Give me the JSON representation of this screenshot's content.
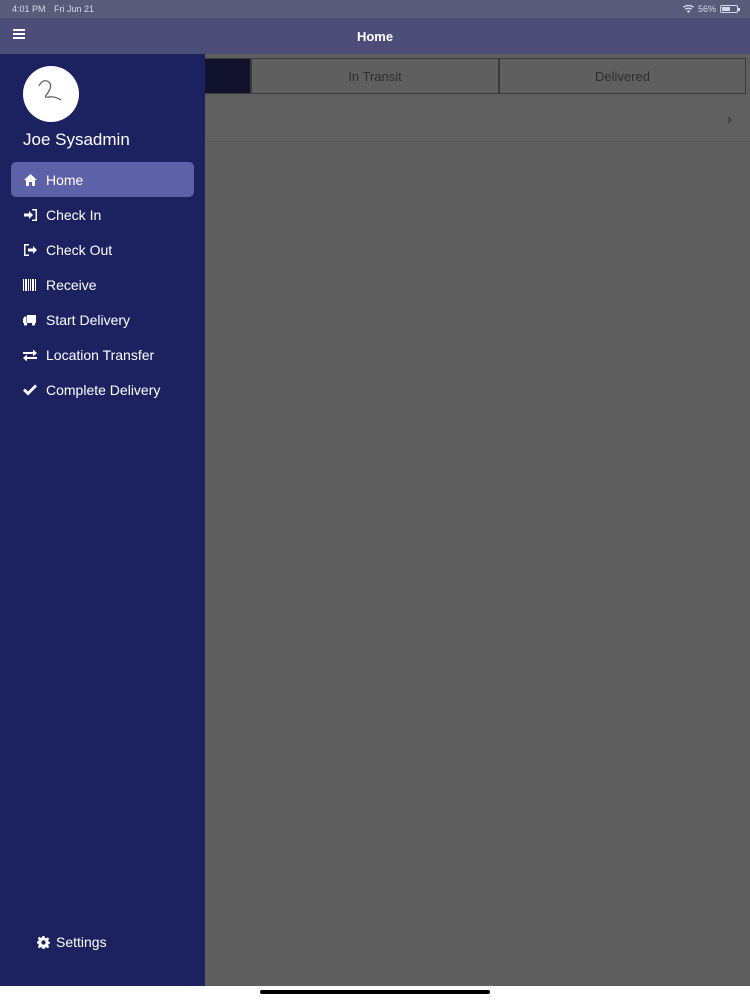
{
  "status_bar": {
    "time": "4:01 PM",
    "date": "Fri Jun 21",
    "battery": "56%",
    "battery_level": 0.56
  },
  "nav": {
    "title": "Home"
  },
  "segments": [
    {
      "label": ""
    },
    {
      "label": "In Transit"
    },
    {
      "label": "Delivered"
    }
  ],
  "drawer": {
    "user_name": "Joe Sysadmin",
    "items": [
      {
        "label": "Home",
        "icon": "home-icon",
        "active": true
      },
      {
        "label": "Check In",
        "icon": "sign-in-icon"
      },
      {
        "label": "Check Out",
        "icon": "sign-out-icon"
      },
      {
        "label": "Receive",
        "icon": "barcode-icon"
      },
      {
        "label": "Start Delivery",
        "icon": "truck-icon"
      },
      {
        "label": "Location Transfer",
        "icon": "exchange-icon"
      },
      {
        "label": "Complete Delivery",
        "icon": "check-icon"
      }
    ],
    "settings_label": "Settings"
  },
  "colors": {
    "drawer_bg": "#1c2260",
    "active_item": "#5c61a8",
    "nav_bg": "#4c4e79"
  }
}
